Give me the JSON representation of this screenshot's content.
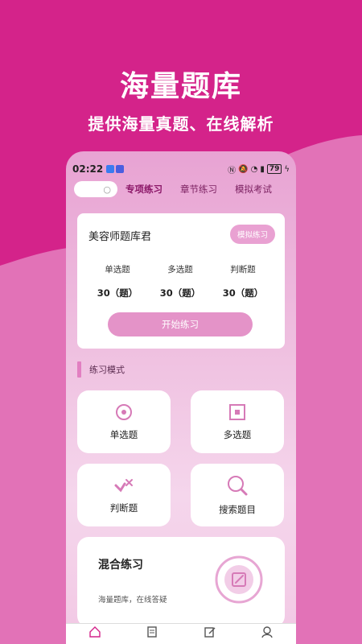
{
  "hero": {
    "title": "海量题库",
    "subtitle": "提供海量真题、在线解析"
  },
  "status_bar": {
    "time": "02:22",
    "battery": "79"
  },
  "tabs": [
    {
      "label": "专项练习",
      "active": true
    },
    {
      "label": "章节练习",
      "active": false
    },
    {
      "label": "模拟考试",
      "active": false
    }
  ],
  "bank": {
    "name": "美容师题库君",
    "mock_label": "模拟练习",
    "stats": [
      {
        "label": "单选题",
        "value": "30（题）"
      },
      {
        "label": "多选题",
        "value": "30（题）"
      },
      {
        "label": "判断题",
        "value": "30（题）"
      }
    ],
    "start_label": "开始练习"
  },
  "section": {
    "title": "练习模式"
  },
  "modes": [
    {
      "label": "单选题",
      "icon": "single-choice-icon"
    },
    {
      "label": "多选题",
      "icon": "multi-choice-icon"
    },
    {
      "label": "判断题",
      "icon": "judge-icon"
    },
    {
      "label": "搜索题目",
      "icon": "search-icon"
    }
  ],
  "mix": {
    "title": "混合练习",
    "subtitle": "海量题库，在线答疑"
  },
  "colors": {
    "brand": "#d4238a",
    "accent": "#e493c8",
    "icon": "#d67ab7"
  }
}
